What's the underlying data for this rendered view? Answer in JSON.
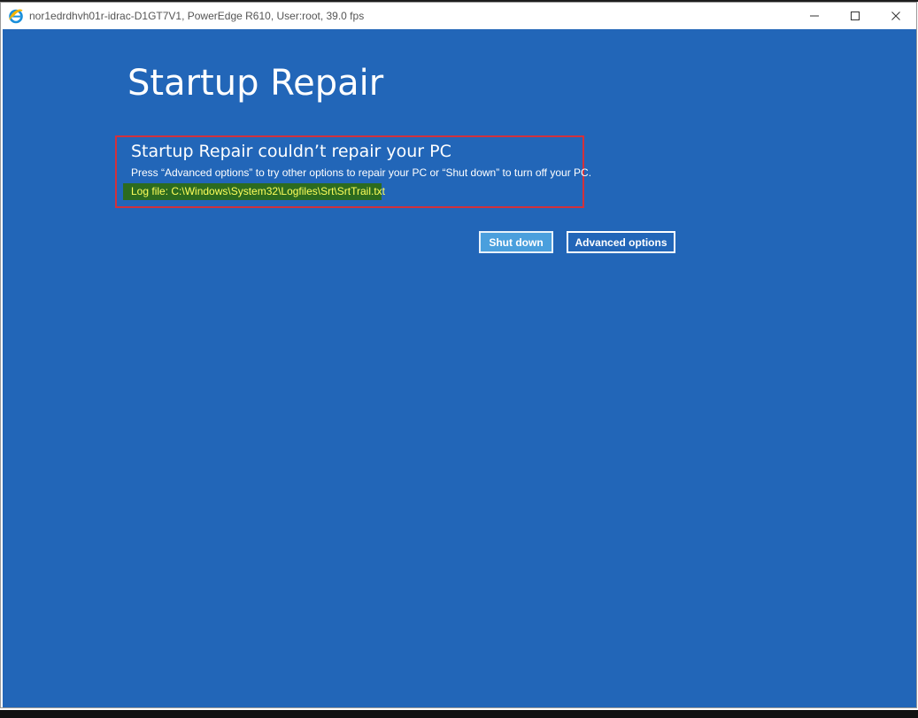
{
  "window": {
    "title": "nor1edrdhvh01r-idrac-D1GT7V1, PowerEdge R610, User:root, 39.0 fps",
    "controls": {
      "minimize_glyph": "—",
      "maximize_glyph": "☐",
      "close_glyph": "✕"
    }
  },
  "screen": {
    "headline": "Startup Repair",
    "error": {
      "title": "Startup Repair couldn’t repair your PC",
      "description": "Press “Advanced options” to try other options to repair your PC or “Shut down” to turn off your PC.",
      "log_file": "Log file: C:\\Windows\\System32\\Logfiles\\Srt\\SrtTrail.txt"
    },
    "buttons": {
      "shutdown_label": "Shut down",
      "advanced_label": "Advanced options"
    }
  },
  "colors": {
    "screen_background": "#2266b8",
    "highlight_border": "#d2313c",
    "log_highlight_bg": "#2c6b1f",
    "log_text": "#ffff5a",
    "primary_button": "#4a9fdd"
  },
  "icons": {
    "app_icon": "internet-explorer-icon"
  }
}
